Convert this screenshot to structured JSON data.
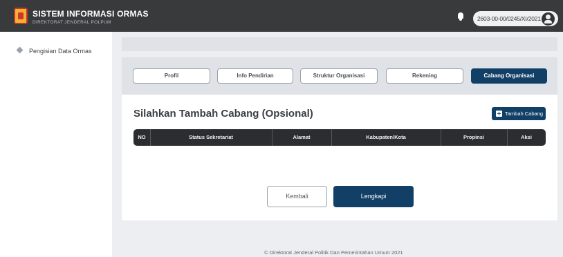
{
  "header": {
    "title": "SISTEM INFORMASI ORMAS",
    "subtitle": "DIREKTORAT JENDERAL POLPUM",
    "logo_icon": "garuda-emblem-icon",
    "notification_icon": "bell-icon",
    "user_id": "2603-00-00/0245/XI/2021",
    "avatar_icon": "user-icon"
  },
  "sidebar": {
    "items": [
      {
        "label": "Pengisian Data Ormas",
        "icon": "diamond-icon"
      }
    ]
  },
  "tabs": [
    {
      "label": "Profil",
      "active": false
    },
    {
      "label": "Info Pendirian",
      "active": false
    },
    {
      "label": "Struktur Organisasi",
      "active": false
    },
    {
      "label": "Rekening",
      "active": false
    },
    {
      "label": "Cabang Organisasi",
      "active": true
    }
  ],
  "main": {
    "section_title": "Silahkan Tambah Cabang (Opsional)",
    "add_button_label": "Tambah Cabang",
    "add_button_icon": "plus-square-icon",
    "table": {
      "headers": [
        "NO",
        "Status Sekretariat",
        "Alamat",
        "Kabupaten/Kota",
        "Propinsi",
        "Aksi"
      ],
      "rows": []
    },
    "back_button_label": "Kembali",
    "submit_button_label": "Lengkapi"
  },
  "footer": {
    "text": "© Direktorat Jenderal Politik Dan Pemerintahan Umum 2021"
  },
  "colors": {
    "primary": "#123f66",
    "topbar": "#383a3c",
    "table_header": "#2b2d30",
    "page_bg": "#eceef1"
  }
}
